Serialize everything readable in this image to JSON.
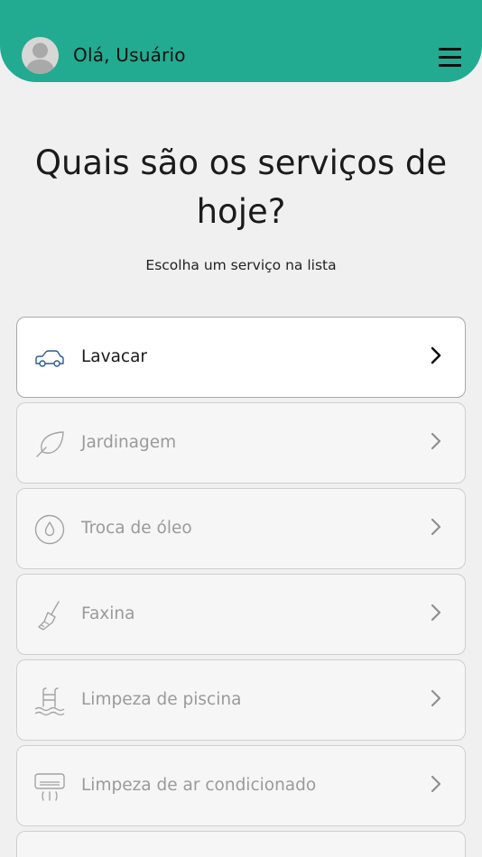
{
  "header": {
    "greeting": "Olá, Usuário",
    "bg_color": "#22ab90",
    "avatar_icon": "user-avatar-icon",
    "menu_icon": "hamburger-menu-icon"
  },
  "main": {
    "title": "Quais são os serviços de hoje?",
    "subtitle": "Escolha um serviço na lista"
  },
  "services": [
    {
      "label": "Lavacar",
      "icon": "car-icon",
      "selected": true
    },
    {
      "label": "Jardinagem",
      "icon": "leaf-icon",
      "selected": false
    },
    {
      "label": "Troca de óleo",
      "icon": "oil-drop-icon",
      "selected": false
    },
    {
      "label": "Faxina",
      "icon": "broom-icon",
      "selected": false
    },
    {
      "label": "Limpeza de piscina",
      "icon": "pool-ladder-icon",
      "selected": false
    },
    {
      "label": "Limpeza de ar condicionado",
      "icon": "air-conditioner-icon",
      "selected": false
    }
  ]
}
